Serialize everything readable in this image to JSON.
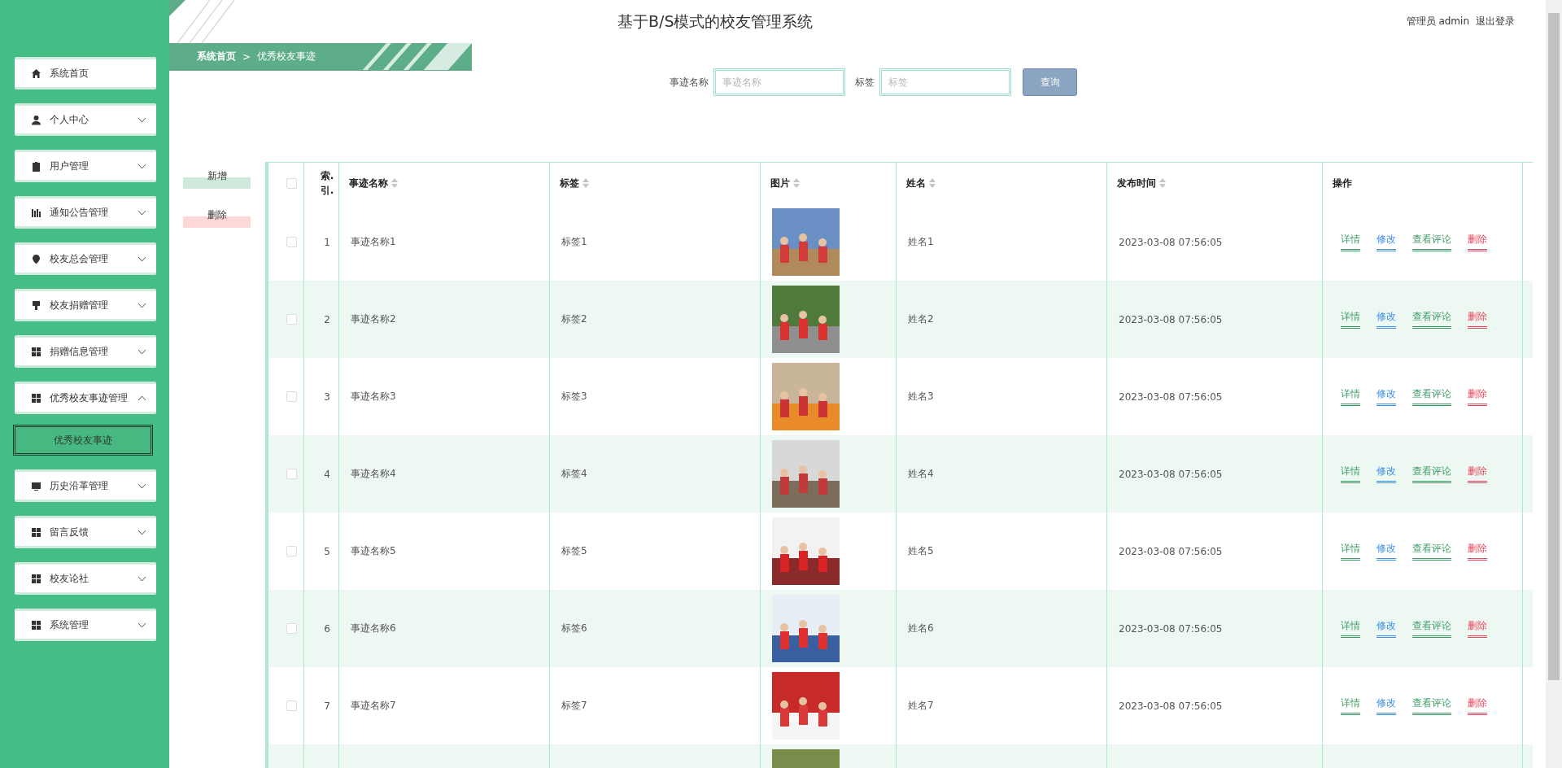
{
  "sidebar": {
    "items": [
      {
        "label": "系统首页",
        "kind": "link"
      },
      {
        "label": "个人中心",
        "kind": "menu",
        "expanded": false
      },
      {
        "label": "用户管理",
        "kind": "menu",
        "expanded": false
      },
      {
        "label": "通知公告管理",
        "kind": "menu",
        "expanded": false
      },
      {
        "label": "校友总会管理",
        "kind": "menu",
        "expanded": false
      },
      {
        "label": "校友捐赠管理",
        "kind": "menu",
        "expanded": false
      },
      {
        "label": "捐赠信息管理",
        "kind": "menu",
        "expanded": false
      },
      {
        "label": "优秀校友事迹管理",
        "kind": "menu",
        "expanded": true,
        "children": [
          {
            "label": "优秀校友事迹",
            "selected": true
          }
        ]
      },
      {
        "label": "历史沿革管理",
        "kind": "menu",
        "expanded": false
      },
      {
        "label": "留言反馈",
        "kind": "menu",
        "expanded": false
      },
      {
        "label": "校友论社",
        "kind": "menu",
        "expanded": false
      },
      {
        "label": "系统管理",
        "kind": "menu",
        "expanded": false
      }
    ]
  },
  "header": {
    "title": "基于B/S模式的校友管理系统",
    "user": "管理员 admin",
    "logout": "退出登录"
  },
  "breadcrumb": [
    "系统首页",
    "优秀校友事迹"
  ],
  "breadcrumb_separator": ">",
  "search": {
    "fields": [
      {
        "label": "事迹名称",
        "placeholder": "事迹名称"
      },
      {
        "label": "标签",
        "placeholder": "标签"
      }
    ],
    "button": "查询"
  },
  "actions": [
    "新增",
    "删除"
  ],
  "table": {
    "select_all": {
      "checked": false
    },
    "columns": [
      {
        "label": "索.\n引.",
        "sortable": false
      },
      {
        "label": "事迹名称",
        "sortable": true
      },
      {
        "label": "标签",
        "sortable": true
      },
      {
        "label": "图片",
        "sortable": true
      },
      {
        "label": "姓名",
        "sortable": true
      },
      {
        "label": "发布时间",
        "sortable": true
      },
      {
        "label": "操作",
        "sortable": false
      }
    ],
    "rows": [
      {
        "checked": false,
        "index": "1",
        "name": "事迹名称1",
        "tag": "标签1",
        "image": {
          "kind": "picture"
        },
        "person": "姓名1",
        "time": "2023-03-08 07:56:05",
        "actions": [
          {
            "label": "详情",
            "color": "#3a9a64"
          },
          {
            "label": "修改",
            "color": "#3a8ee6"
          },
          {
            "label": "查看评论",
            "color": "#3a9a64"
          },
          {
            "label": "删除",
            "color": "#e8455a"
          }
        ]
      },
      {
        "checked": false,
        "index": "2",
        "name": "事迹名称2",
        "tag": "标签2",
        "image": {
          "kind": "picture"
        },
        "person": "姓名2",
        "time": "2023-03-08 07:56:05",
        "actions": [
          {
            "label": "详情",
            "color": "#3a9a64"
          },
          {
            "label": "修改",
            "color": "#3a8ee6"
          },
          {
            "label": "查看评论",
            "color": "#3a9a64"
          },
          {
            "label": "删除",
            "color": "#e8455a"
          }
        ]
      },
      {
        "checked": false,
        "index": "3",
        "name": "事迹名称3",
        "tag": "标签3",
        "image": {
          "kind": "picture"
        },
        "person": "姓名3",
        "time": "2023-03-08 07:56:05",
        "actions": [
          {
            "label": "详情",
            "color": "#3a9a64"
          },
          {
            "label": "修改",
            "color": "#3a8ee6"
          },
          {
            "label": "查看评论",
            "color": "#3a9a64"
          },
          {
            "label": "删除",
            "color": "#e8455a"
          }
        ]
      },
      {
        "checked": false,
        "index": "4",
        "name": "事迹名称4",
        "tag": "标签4",
        "image": {
          "kind": "picture"
        },
        "person": "姓名4",
        "time": "2023-03-08 07:56:05",
        "actions": [
          {
            "label": "详情",
            "color": "#3a9a64"
          },
          {
            "label": "修改",
            "color": "#3a8ee6"
          },
          {
            "label": "查看评论",
            "color": "#3a9a64"
          },
          {
            "label": "删除",
            "color": "#e8455a"
          }
        ]
      },
      {
        "checked": false,
        "index": "5",
        "name": "事迹名称5",
        "tag": "标签5",
        "image": {
          "kind": "picture"
        },
        "person": "姓名5",
        "time": "2023-03-08 07:56:05",
        "actions": [
          {
            "label": "详情",
            "color": "#3a9a64"
          },
          {
            "label": "修改",
            "color": "#3a8ee6"
          },
          {
            "label": "查看评论",
            "color": "#3a9a64"
          },
          {
            "label": "删除",
            "color": "#e8455a"
          }
        ]
      },
      {
        "checked": false,
        "index": "6",
        "name": "事迹名称6",
        "tag": "标签6",
        "image": {
          "kind": "picture"
        },
        "person": "姓名6",
        "time": "2023-03-08 07:56:05",
        "actions": [
          {
            "label": "详情",
            "color": "#3a9a64"
          },
          {
            "label": "修改",
            "color": "#3a8ee6"
          },
          {
            "label": "查看评论",
            "color": "#3a9a64"
          },
          {
            "label": "删除",
            "color": "#e8455a"
          }
        ]
      },
      {
        "checked": false,
        "index": "7",
        "name": "事迹名称7",
        "tag": "标签7",
        "image": {
          "kind": "picture"
        },
        "person": "姓名7",
        "time": "2023-03-08 07:56:05",
        "actions": [
          {
            "label": "详情",
            "color": "#3a9a64"
          },
          {
            "label": "修改",
            "color": "#3a8ee6"
          },
          {
            "label": "查看评论",
            "color": "#3a9a64"
          },
          {
            "label": "删除",
            "color": "#e8455a"
          }
        ]
      },
      {
        "image": {
          "kind": "picture"
        }
      }
    ]
  }
}
